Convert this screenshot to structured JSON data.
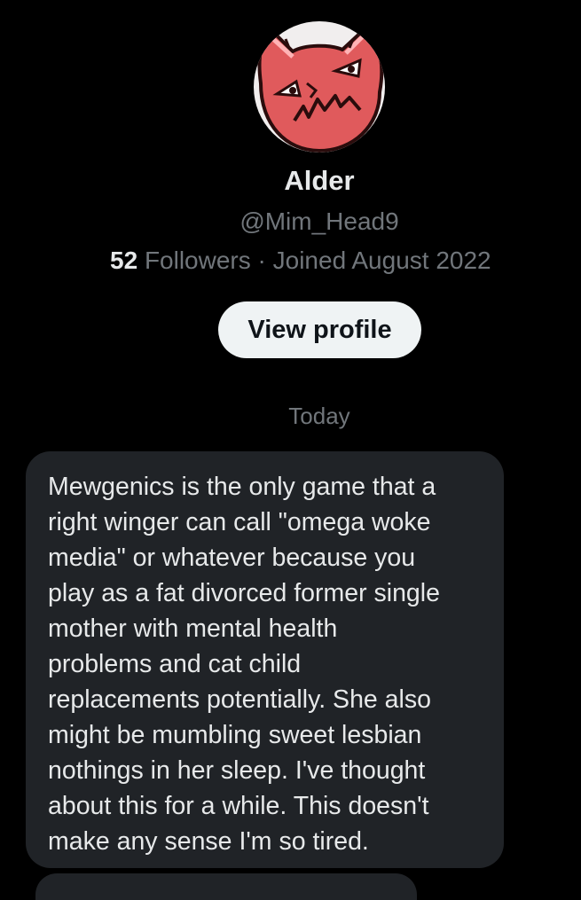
{
  "profile": {
    "name": "Alder",
    "handle": "@Mim_Head9",
    "followers_count": "52",
    "followers_label": "Followers",
    "separator": "·",
    "joined": "Joined August 2022",
    "view_profile_label": "View profile",
    "avatar_icon": "angry-red-cat-avatar",
    "avatar_color": "#e05a5c"
  },
  "conversation": {
    "date_label": "Today",
    "messages": [
      {
        "text": "Mewgenics is the only game that a\nright winger can call \"omega woke\nmedia\" or whatever because you\nplay as a fat divorced former single\nmother with mental health\nproblems and cat child\nreplacements potentially. She also\nmight be mumbling sweet lesbian\nnothings in her sleep. I've thought\nabout this for a while. This doesn't\nmake any sense I'm so tired."
      }
    ]
  },
  "colors": {
    "background": "#000000",
    "bubble": "#202327",
    "primary_text": "#e7e9ea",
    "secondary_text": "#71767b",
    "button_bg": "#eff3f4"
  }
}
